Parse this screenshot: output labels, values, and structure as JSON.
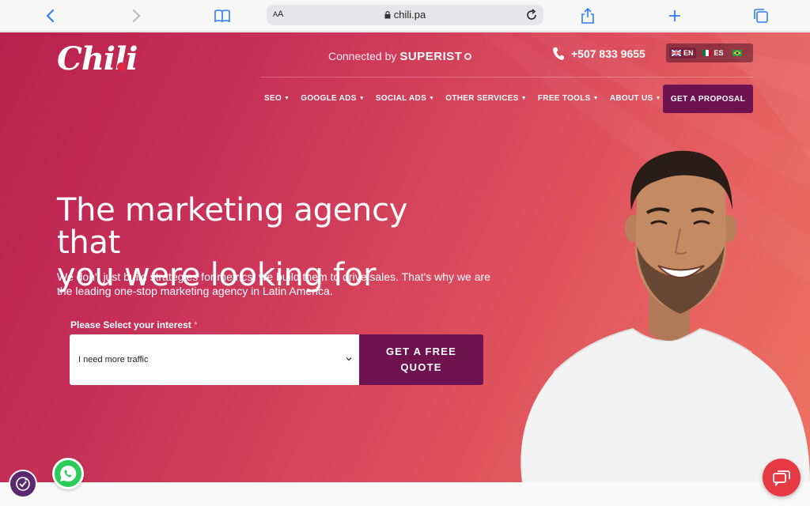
{
  "browser": {
    "text_size_label": "AA",
    "url": "chili.pa"
  },
  "site": {
    "logo_text": "Chili",
    "connected_by": "Connected by",
    "partner": "SUPERIST",
    "phone": "+507 833 9655",
    "languages": [
      {
        "code": "EN",
        "active": true
      },
      {
        "code": "ES",
        "active": false
      },
      {
        "code": "",
        "active": false
      }
    ],
    "nav": [
      "SEO",
      "GOOGLE ADS",
      "SOCIAL ADS",
      "OTHER SERVICES",
      "FREE TOOLS",
      "ABOUT US"
    ],
    "cta": "GET A PROPOSAL"
  },
  "hero": {
    "headline_line1": "The marketing agency that",
    "headline_line2": "you were looking for",
    "subtext": "We don't just build strategies for metrics; we build them to drive sales. That's why we are the leading one-stop marketing agency in Latin America.",
    "form_label": "Please Select your interest",
    "required_mark": "*",
    "select_value": "I need more traffic",
    "quote_line1": "GET A FREE",
    "quote_line2": "QUOTE"
  },
  "colors": {
    "brand_dark": "#6e1250",
    "hero_start": "#b8204f",
    "hero_end": "#ee7263",
    "whatsapp": "#2ccc5a",
    "chat": "#e63a44"
  }
}
